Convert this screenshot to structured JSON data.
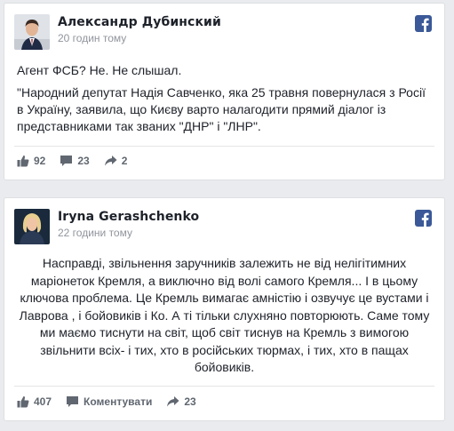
{
  "posts": [
    {
      "author": "Александр Дубинский",
      "time": "20 годин тому",
      "paragraphs": [
        "Агент ФСБ? Не. Не слышал.",
        "\"Народний депутат Надія Савченко, яка 25 травня повернулася з Росії в Україну, заявила, що Києву варто налагодити прямий діалог із представниками так званих \"ДНР\" і \"ЛНР\"."
      ],
      "footer": {
        "likes": "92",
        "comments": "23",
        "shares": "2"
      },
      "icons": {
        "logo": "facebook-icon",
        "like": "thumbs-up-icon",
        "comment": "comment-icon",
        "share": "share-arrow-icon"
      }
    },
    {
      "author": "Iryna Gerashchenko",
      "time": "22 години тому",
      "paragraphs": [
        "Насправді, звільнення заручників залежить не від нелігітимних маріонеток Кремля, а виключно від волі самого Кремля... І в цьому ключова проблема. Це Кремль вимагає амністію і озвучує це вустами і Лаврова , і бойовиків і Ко. А ті тільки слухняно повторюють. Саме тому ми маємо тиснути на світ, щоб світ тиснув на Кремль з вимогою звільнити всіх- і тих, хто в російських тюрмах, і тих, хто в пащах бойовиків."
      ],
      "footer": {
        "likes": "407",
        "comments_label": "Коментувати",
        "shares": "23"
      },
      "icons": {
        "logo": "facebook-icon",
        "like": "thumbs-up-icon",
        "comment": "comment-icon",
        "share": "share-arrow-icon"
      }
    }
  ],
  "colors": {
    "background": "#e9ebee",
    "facebook_blue": "#3b5998",
    "secondary_text": "#90949c",
    "footer_text": "#606770"
  }
}
